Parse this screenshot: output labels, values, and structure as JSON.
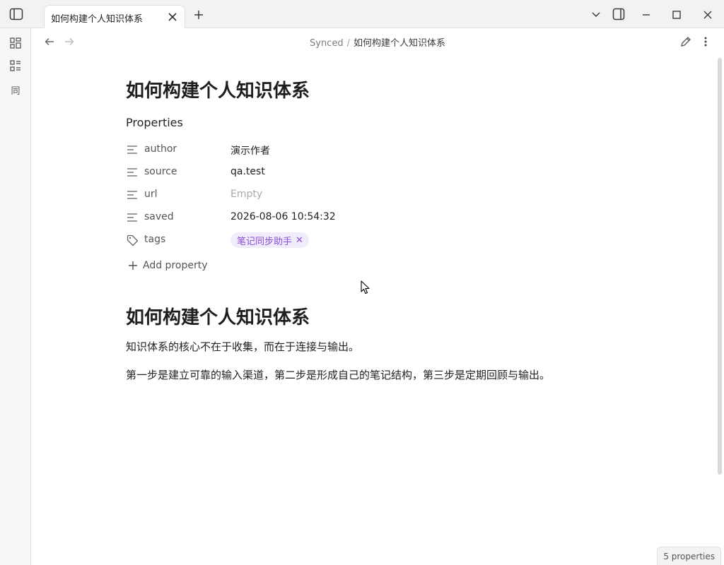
{
  "window": {
    "tab_title": "如何构建个人知识体系",
    "icons": {
      "sidebar_toggle": "sidebar-toggle-icon",
      "tab_close": "close-icon",
      "new_tab": "plus-icon",
      "tab_list": "chevron-down-icon",
      "right_sidebar": "sidebar-right-icon",
      "minimize": "minimize-icon",
      "maximize": "maximize-icon",
      "close": "window-close-icon"
    }
  },
  "ribbon": {
    "items": [
      {
        "name": "grid-icon"
      },
      {
        "name": "list-icon"
      },
      {
        "name": "sync-char-icon",
        "glyph": "同"
      }
    ]
  },
  "nav": {
    "breadcrumb_folder": "Synced",
    "breadcrumb_sep": "/",
    "breadcrumb_file": "如何构建个人知识体系"
  },
  "note": {
    "inline_title": "如何构建个人知识体系",
    "properties_heading": "Properties",
    "properties": [
      {
        "key": "author",
        "value": "演示作者",
        "icon": "text-lines-icon"
      },
      {
        "key": "source",
        "value": "qa.test",
        "icon": "text-lines-icon"
      },
      {
        "key": "url",
        "value": "Empty",
        "icon": "text-lines-icon",
        "empty": true
      },
      {
        "key": "saved",
        "value": "2026-08-06 10:54:32",
        "icon": "text-lines-icon"
      },
      {
        "key": "tags",
        "icon": "tag-icon",
        "tags": [
          "笔记同步助手"
        ]
      }
    ],
    "add_property_label": "Add property",
    "heading": "如何构建个人知识体系",
    "paragraphs": [
      "知识体系的核心不在于收集，而在于连接与输出。",
      "第一步是建立可靠的输入渠道，第二步是形成自己的笔记结构，第三步是定期回顾与输出。"
    ]
  },
  "status": {
    "properties_count": "5 properties"
  },
  "colors": {
    "tag_text": "#8a4ed9",
    "tag_bg": "#f1ecfb",
    "empty_value": "#aaaaaa"
  }
}
